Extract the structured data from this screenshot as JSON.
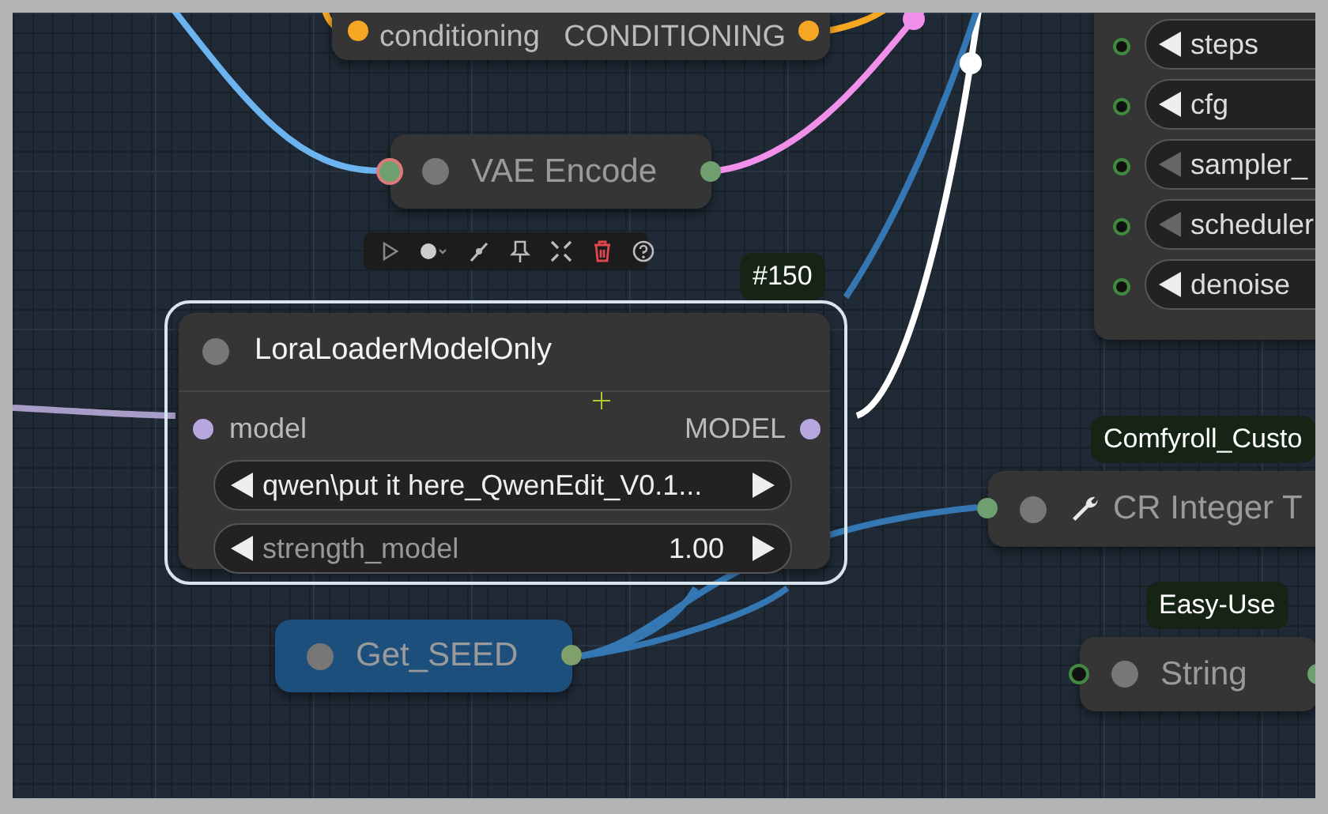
{
  "nodes": [
    {
      "kind": "io_row",
      "color": "#353535",
      "input_label": "conditioning",
      "output_label": "CONDITIONING",
      "ports": [
        {
          "kind": "input",
          "linked": true,
          "color": "#f5a623"
        },
        {
          "kind": "output",
          "linked": true,
          "color": "#f5a623"
        }
      ]
    },
    {
      "kind": "collapsed",
      "color": "#353535",
      "title": "VAE Encode",
      "ports": [
        {
          "kind": "input",
          "linked": true,
          "highlight": true,
          "color": "#6f9f6f"
        },
        {
          "kind": "output",
          "linked": true,
          "color": "#6f9f6f"
        }
      ]
    },
    {
      "kind": "full",
      "color": "#353535",
      "badge": "#150",
      "title": "LoraLoaderModelOnly",
      "selected": true,
      "input_label": "model",
      "output_label": "MODEL",
      "ports": [
        {
          "kind": "input",
          "linked": true,
          "color": "#b8a6de"
        },
        {
          "kind": "output",
          "linked": true,
          "color": "#b8a6de"
        }
      ],
      "widgets": [
        {
          "kind": "combo",
          "value": "qwen\\put it here_QwenEdit_V0.1..."
        },
        {
          "kind": "number",
          "label": "strength_model",
          "value": "1.00"
        }
      ]
    },
    {
      "kind": "widgets",
      "color": "#353535",
      "widgets": [
        {
          "label": "steps",
          "disabled": false
        },
        {
          "label": "cfg",
          "disabled": false
        },
        {
          "label": "sampler_",
          "disabled": true
        },
        {
          "label": "scheduler",
          "disabled": true
        },
        {
          "label": "denoise",
          "disabled": false
        }
      ]
    },
    {
      "kind": "collapsed",
      "color": "#1d4f7c",
      "title": "Get_SEED",
      "ports": [
        {
          "kind": "output",
          "linked": true,
          "color": "#7fa06a"
        }
      ]
    },
    {
      "kind": "collapsed",
      "color": "#353535",
      "badge": "Comfyroll_Custo",
      "title": "CR Integer T",
      "icon": true,
      "ports": [
        {
          "kind": "input",
          "linked": true,
          "color": "#6f9f6f"
        }
      ]
    },
    {
      "kind": "collapsed",
      "color": "#353535",
      "badge": "Easy-Use",
      "title": "String",
      "ports": [
        {
          "kind": "input",
          "linked": false,
          "color": "#3f8a3f"
        },
        {
          "kind": "output",
          "linked": true,
          "color": "#6f9f6f"
        }
      ]
    }
  ]
}
